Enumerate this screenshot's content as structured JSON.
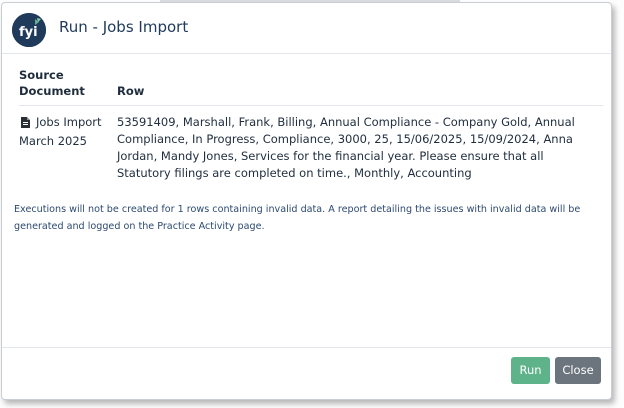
{
  "dialog": {
    "title": "Run - Jobs Import",
    "logo_text": "fyi"
  },
  "table": {
    "headers": {
      "source_document": "Source Document",
      "row": "Row"
    },
    "rows": [
      {
        "source_document": "Jobs Import March 2025",
        "row": "53591409, Marshall, Frank, Billing, Annual Compliance - Company Gold, Annual Compliance, In Progress, Compliance, 3000, 25, 15/06/2025, 15/09/2024, Anna Jordan, Mandy Jones, Services for the financial year. Please ensure that all Statutory filings are completed on time., Monthly, Accounting"
      }
    ]
  },
  "notice": "Executions will not be created for 1 rows containing invalid data. A report detailing the issues with invalid data will be generated and logged on the Practice Activity page.",
  "buttons": {
    "run": "Run",
    "close": "Close"
  },
  "colors": {
    "brand_navy": "#1f3a5a",
    "brand_green": "#5fb38a",
    "run_button": "#5fb38a",
    "close_button": "#6c757d",
    "notice_text": "#2d4a72"
  },
  "icons": {
    "logo": "fyi-logo-icon",
    "document": "file-icon"
  }
}
